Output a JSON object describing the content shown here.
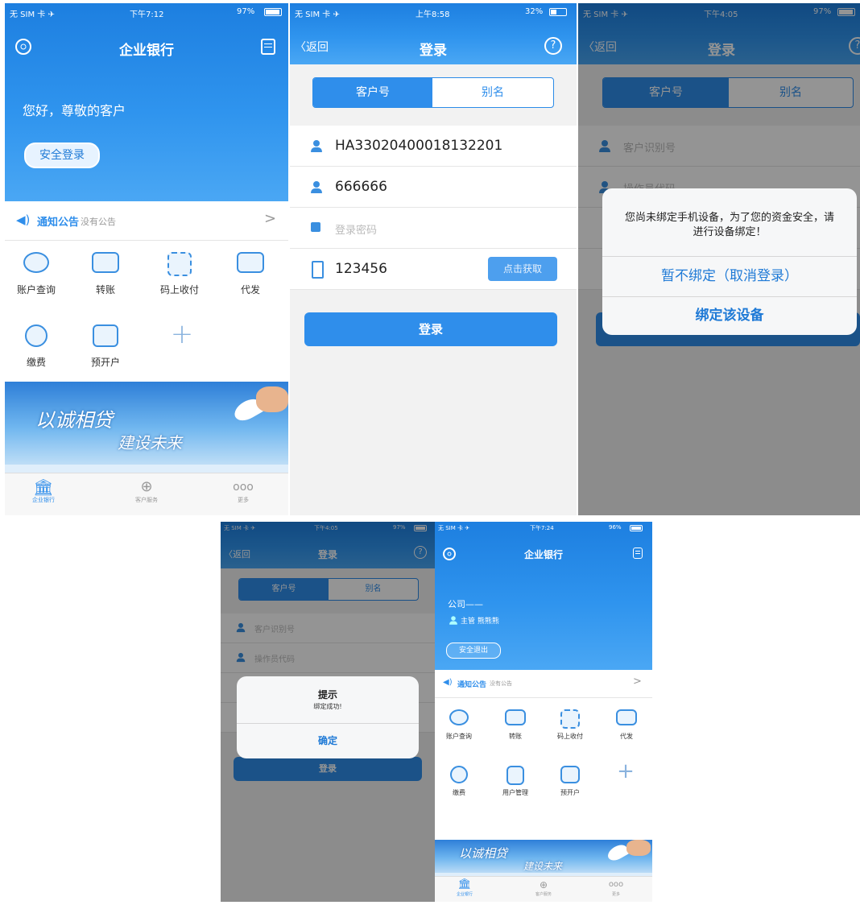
{
  "colors": {
    "brand_blue": "#2f8eeb",
    "overlay": "rgba(0,0,0,0.42)",
    "dialog_blue_text": "#1f7ad6"
  },
  "home1": {
    "status": {
      "carrier": "无 SIM 卡 ✈",
      "time": "下午7:12",
      "battery": "97%"
    },
    "title": "企业银行",
    "greeting": "您好，尊敬的客户",
    "login_button": "安全登录",
    "notice_label": "通知公告",
    "notice_text": "没有公告",
    "grid": [
      "账户查询",
      "转账",
      "码上收付",
      "代发",
      "缴费",
      "预开户"
    ],
    "banner_text1": "以诚相贷",
    "banner_text2": "建设未来",
    "tabs": [
      "企业银行",
      "客户服务",
      "更多"
    ]
  },
  "login1": {
    "status": {
      "carrier": "无 SIM 卡 ✈",
      "time": "上午8:58",
      "battery": "32%"
    },
    "back": "〈返回",
    "title": "登录",
    "seg_active": "客户号",
    "seg_inactive": "别名",
    "customer_id": "HA33020400018132201",
    "operator_code": "666666",
    "password_placeholder": "登录密码",
    "sms_code": "123456",
    "sms_button": "点击获取",
    "submit": "登录"
  },
  "login2": {
    "status": {
      "carrier": "无 SIM 卡 ✈",
      "time": "下午4:05",
      "battery": "97%"
    },
    "back": "〈返回",
    "title": "登录",
    "seg_active": "客户号",
    "seg_inactive": "别名",
    "field1_placeholder": "客户识别号",
    "field2_placeholder": "操作员代码",
    "dialog_message": "您尚未绑定手机设备，为了您的资金安全，请进行设备绑定！",
    "dialog_cancel": "暂不绑定（取消登录）",
    "dialog_bind": "绑定该设备"
  },
  "login3": {
    "status": {
      "carrier": "无 SIM 卡 ✈",
      "time": "下午4:05",
      "battery": "97%"
    },
    "back": "〈返回",
    "title": "登录",
    "seg_active": "客户号",
    "seg_inactive": "别名",
    "field1_placeholder": "客户识别号",
    "field2_placeholder": "操作员代码",
    "dialog_title": "提示",
    "dialog_message": "绑定成功!",
    "dialog_ok": "确定",
    "submit": "登录"
  },
  "home2": {
    "status": {
      "carrier": "无 SIM 卡 ✈",
      "time": "下午7:24",
      "battery": "96%"
    },
    "title": "企业银行",
    "company": "公司——",
    "user": "主管 熊熊熊",
    "logout_button": "安全退出",
    "notice_label": "通知公告",
    "notice_text": "没有公告",
    "grid": [
      "账户查询",
      "转账",
      "码上收付",
      "代发",
      "缴费",
      "用户管理",
      "预开户"
    ],
    "banner_text1": "以诚相贷",
    "banner_text2": "建设未来",
    "tabs": [
      "企业银行",
      "客户服务",
      "更多"
    ]
  }
}
